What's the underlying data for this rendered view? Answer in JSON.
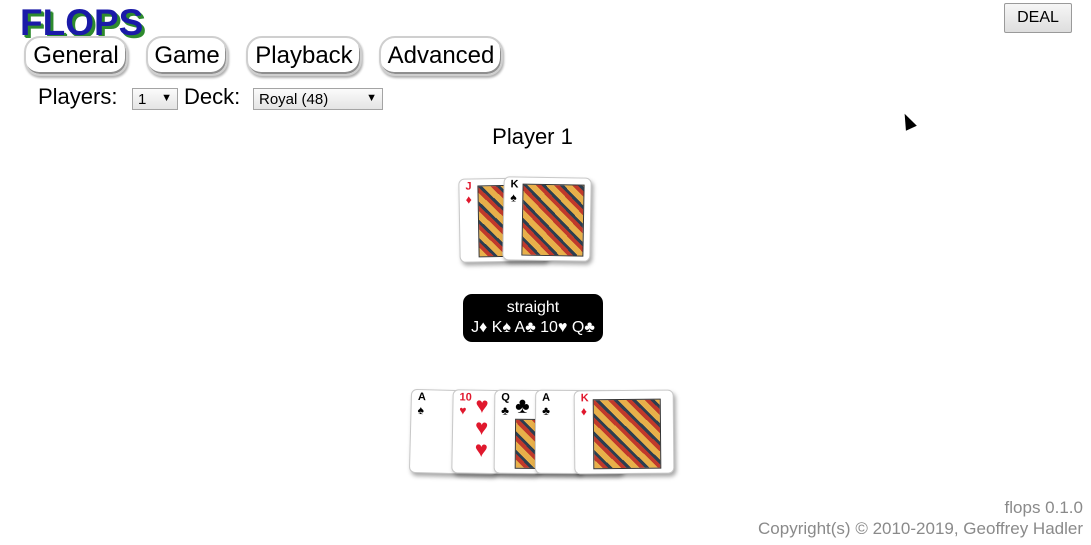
{
  "app": {
    "logo": "FLOPS"
  },
  "toolbar": {
    "deal_label": "DEAL"
  },
  "tabs": [
    {
      "label": "General"
    },
    {
      "label": "Game"
    },
    {
      "label": "Playback"
    },
    {
      "label": "Advanced"
    }
  ],
  "controls": {
    "players_label": "Players:",
    "players_value": "1",
    "deck_label": "Deck:",
    "deck_value": "Royal (48)"
  },
  "player": {
    "title": "Player 1",
    "hole_cards": [
      {
        "rank": "J",
        "suit": "♦",
        "color": "#e0182d"
      },
      {
        "rank": "K",
        "suit": "♠",
        "color": "#000000"
      }
    ],
    "hand_name": "straight",
    "hand_cards": "J♦ K♠ A♣ 10♥ Q♣"
  },
  "board": [
    {
      "rank": "A",
      "suit": "♠",
      "color": "#000000"
    },
    {
      "rank": "10",
      "suit": "♥",
      "color": "#e0182d"
    },
    {
      "rank": "Q",
      "suit": "♣",
      "color": "#000000"
    },
    {
      "rank": "A",
      "suit": "♣",
      "color": "#000000"
    },
    {
      "rank": "K",
      "suit": "♦",
      "color": "#e0182d"
    }
  ],
  "footer": {
    "version": "flops 0.1.0",
    "copyright": "Copyright(s) © 2010-2019, Geoffrey Hadler"
  }
}
